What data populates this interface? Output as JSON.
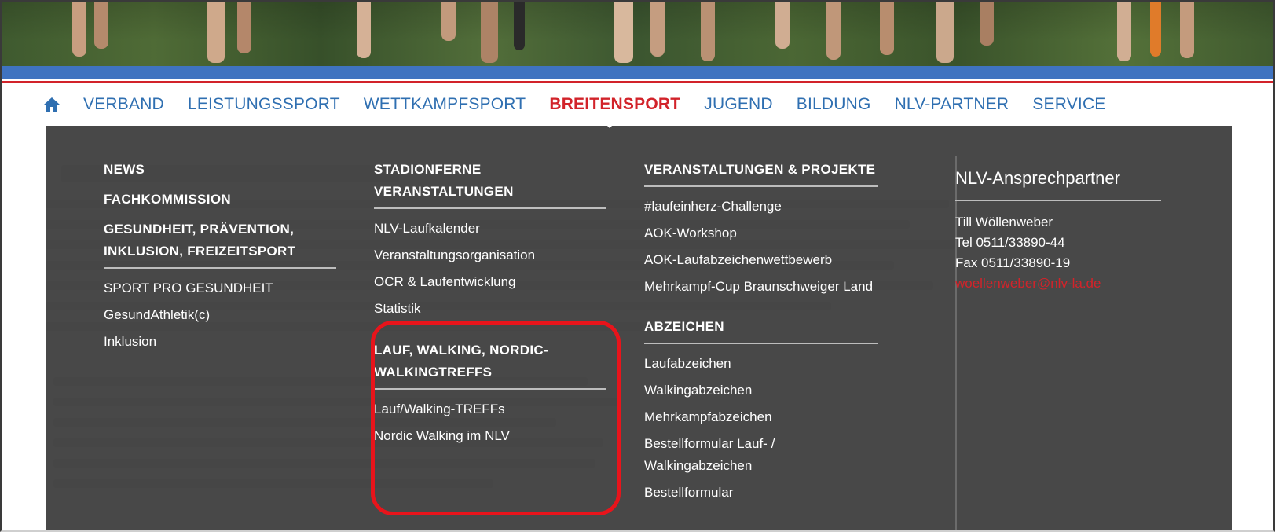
{
  "nav": {
    "home_icon": "home-icon",
    "items": [
      {
        "label": "VERBAND",
        "active": false
      },
      {
        "label": "LEISTUNGSSPORT",
        "active": false
      },
      {
        "label": "WETTKAMPFSPORT",
        "active": false
      },
      {
        "label": "BREITENSPORT",
        "active": true
      },
      {
        "label": "JUGEND",
        "active": false
      },
      {
        "label": "BILDUNG",
        "active": false
      },
      {
        "label": "NLV-PARTNER",
        "active": false
      },
      {
        "label": "SERVICE",
        "active": false
      }
    ]
  },
  "menu": {
    "col1": {
      "news": "NEWS",
      "fachkommission": "FACHKOMMISSION",
      "gesundheit_head": "GESUNDHEIT, PRÄVENTION, INKLUSION, FREIZEITSPORT",
      "links": [
        "SPORT PRO GESUNDHEIT",
        "GesundAthletik(c)",
        "Inklusion"
      ]
    },
    "col2": {
      "stadionferne_head": "STADIONFERNE VERANSTALTUNGEN",
      "stadionferne_links": [
        "NLV-Laufkalender",
        "Veranstaltungsorganisation",
        "OCR & Laufentwicklung",
        "Statistik"
      ],
      "lauf_head": "LAUF, WALKING, NORDIC-WALKINGTREFFS",
      "lauf_links": [
        "Lauf/Walking-TREFFs",
        "Nordic Walking im NLV"
      ]
    },
    "col3": {
      "veranstaltungen_head": "VERANSTALTUNGEN & PROJEKTE",
      "veranstaltungen_links": [
        "#laufeinherz-Challenge",
        "AOK-Workshop",
        "AOK-Laufabzeichenwettbewerb",
        "Mehrkampf-Cup Braunschweiger Land"
      ],
      "abzeichen_head": "ABZEICHEN",
      "abzeichen_links": [
        "Laufabzeichen",
        "Walkingabzeichen",
        "Mehrkampfabzeichen",
        "Bestellformular Lauf- / Walkingabzeichen",
        "Bestellformular"
      ]
    },
    "contact": {
      "title": "NLV-Ansprechpartner",
      "name": "Till Wöllenweber",
      "tel": "Tel 0511/33890-44",
      "fax": "Fax 0511/33890-19",
      "email": "woellenweber@nlv-la.de"
    }
  },
  "colors": {
    "nav_link": "#2f6fb1",
    "nav_active": "#d2232a",
    "menu_bg": "#3a3a3a",
    "highlight": "#e8141b"
  }
}
